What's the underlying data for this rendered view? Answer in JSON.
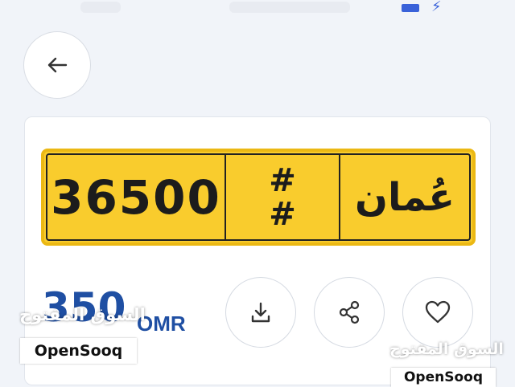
{
  "plate": {
    "number": "36500",
    "code_line1": "#",
    "code_line2": "#",
    "country": "عُمان"
  },
  "price": {
    "amount": "350",
    "currency": "OMR"
  },
  "watermark": {
    "arabic": "السوق المفتوح",
    "brand": "OpenSooq"
  },
  "icons": {
    "back": "arrow-left-icon",
    "download": "download-icon",
    "share": "share-icon",
    "favorite": "heart-icon",
    "charging": "bolt-icon",
    "battery": "battery-icon"
  },
  "colors": {
    "plate_yellow": "#f9cc2d",
    "price_blue": "#1f4fa3",
    "accent_blue": "#3a62d9"
  }
}
